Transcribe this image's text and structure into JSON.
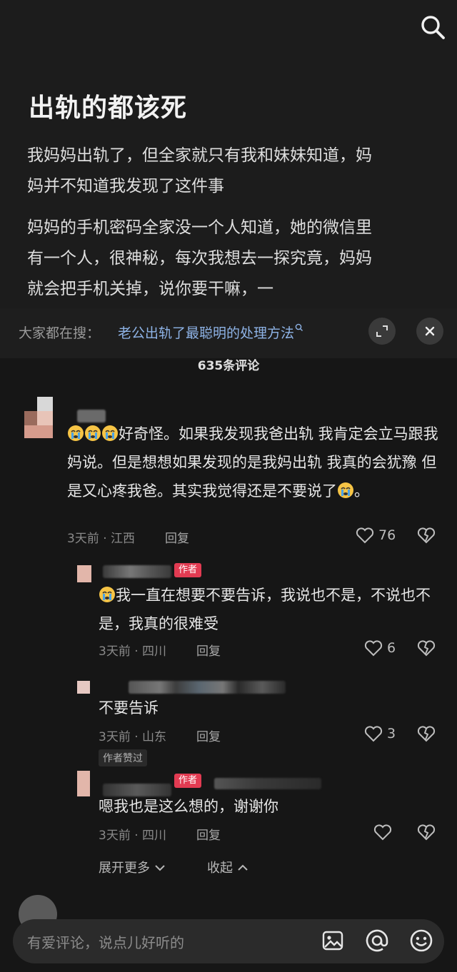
{
  "article": {
    "title": "出轨的都该死",
    "para1": "我妈妈出轨了，但全家就只有我和妹妹知道，妈妈并不知道我发现了这件事",
    "para2": "妈妈的手机密码全家没一个人知道，她的微信里有一个人，很神秘，每次我想去一探究竟，妈妈就会把手机关掉，说你要干嘛，一"
  },
  "suggestion": {
    "prefix": "大家都在搜：",
    "query": "老公出轨了最聪明的处理方法"
  },
  "comments_header": "635条评论",
  "comments": [
    {
      "text": "好奇怪。如果我发现我爸出轨 我肯定会立马跟我妈说。但是想想如果发现的是我妈出轨 我真的会犹豫 但是又心疼我爸。其实我觉得还是不要说了",
      "text_end": "。",
      "time_loc": "3天前 · 江西",
      "reply_label": "回复",
      "likes": "76"
    }
  ],
  "replies": [
    {
      "badge": "作者",
      "text": "我一直在想要不要告诉，我说也不是，不说也不是，我真的很难受",
      "time_loc": "3天前 · 四川",
      "reply_label": "回复",
      "likes": "6"
    },
    {
      "text": "不要告诉",
      "time_loc": "3天前 · 山东",
      "reply_label": "回复",
      "likes": "3"
    },
    {
      "liked_tag": "作者赞过",
      "badge": "作者",
      "text": "嗯我也是这么想的，谢谢你",
      "time_loc": "3天前 · 四川",
      "reply_label": "回复",
      "likes": ""
    }
  ],
  "thread_controls": {
    "expand_more": "展开更多",
    "collapse": "收起"
  },
  "input": {
    "placeholder": "有爱评论，说点儿好听的"
  },
  "colors": {
    "background": "#161616",
    "accent_badge": "#e23b52",
    "link": "#8eb3e6"
  }
}
